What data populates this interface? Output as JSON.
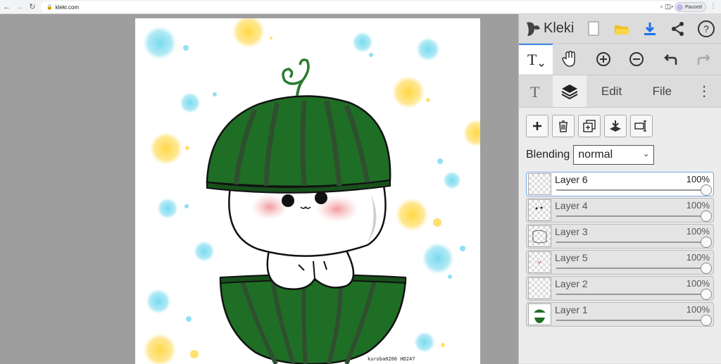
{
  "browser": {
    "url": "kleki.com",
    "profile_status": "Paused"
  },
  "app": {
    "logo_text": "Kleki"
  },
  "tabs": [
    {
      "label": "Edit"
    },
    {
      "label": "File"
    }
  ],
  "layers_panel": {
    "blending_label": "Blending",
    "blending_value": "normal",
    "layers": [
      {
        "name": "Layer 6",
        "opacity": "100%",
        "selected": true
      },
      {
        "name": "Layer 4",
        "opacity": "100%",
        "selected": false
      },
      {
        "name": "Layer 3",
        "opacity": "100%",
        "selected": false
      },
      {
        "name": "Layer 5",
        "opacity": "100%",
        "selected": false
      },
      {
        "name": "Layer 2",
        "opacity": "100%",
        "selected": false
      },
      {
        "name": "Layer 1",
        "opacity": "100%",
        "selected": false
      }
    ]
  },
  "canvas": {
    "watermark": "kuroba0206 HD247"
  },
  "colors": {
    "accent_blue": "#1a73e8",
    "watermelon_green": "#1e6b24",
    "dark_stripe": "#2a4a2a",
    "dot_cyan": "#7fdcef",
    "dot_yellow": "#ffd84a",
    "blush": "#f3a5a8"
  }
}
